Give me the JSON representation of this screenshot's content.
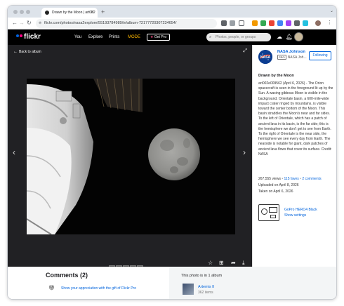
{
  "browser": {
    "tab_title": "Drawn by the Moon | art002",
    "url": "flickr.com/photos/nasa2explore/55193784989/in/album-72177720307234654/"
  },
  "flickr_header": {
    "logo": "flickr",
    "nav": [
      "You",
      "Explore",
      "Prints",
      "MODE"
    ],
    "get_pro": "Get Pro",
    "search_placeholder": "Photos, people, or groups"
  },
  "viewer": {
    "back_label": "Back to album"
  },
  "sidebar": {
    "owner_name": "NASA Johnson",
    "pro_badge": "PRO",
    "owner_sub": "NASA Joh...",
    "follow_label": "Following",
    "photo_title": "Drawn by the Moon",
    "description": "art002e009562 (April 6, 2026) - The Orion spacecraft is seen in the foreground lit up by the Sun. A waxing gibbous Moon is visible in the background. Orientale basin, a 600-mile-wide impact crater ringed by mountains, is visible toward the center bottom of the Moon. This basin straddles the Moon's near and far sides. To the left of Orientale, which has a patch of ancient lava in its basin, is the far side; this is the hemisphere we don't get to see from Earth. To the right of Orientale is the near side, the hemisphere we see every day from Earth. The nearside is notable for giant, dark patches of ancient lava flows that cover its surface. Credit: NASA",
    "views": "267,555 views",
    "faves": "115 faves",
    "comments_count": "2 comments",
    "uploaded": "Uploaded on April 8, 2026",
    "taken": "Taken on April 6, 2026",
    "camera_name": "GoPro HERO4 Black",
    "camera_settings": "Show settings"
  },
  "comments": {
    "title": "Comments (2)",
    "gift_text": "Show your appreciation with the gift of Flickr Pro"
  },
  "album": {
    "heading": "This photo is in 1 album",
    "name": "Artemis II",
    "count": "362 items"
  },
  "colors": {
    "flickr_blue": "#0063dc",
    "flickr_pink": "#ff0084"
  }
}
